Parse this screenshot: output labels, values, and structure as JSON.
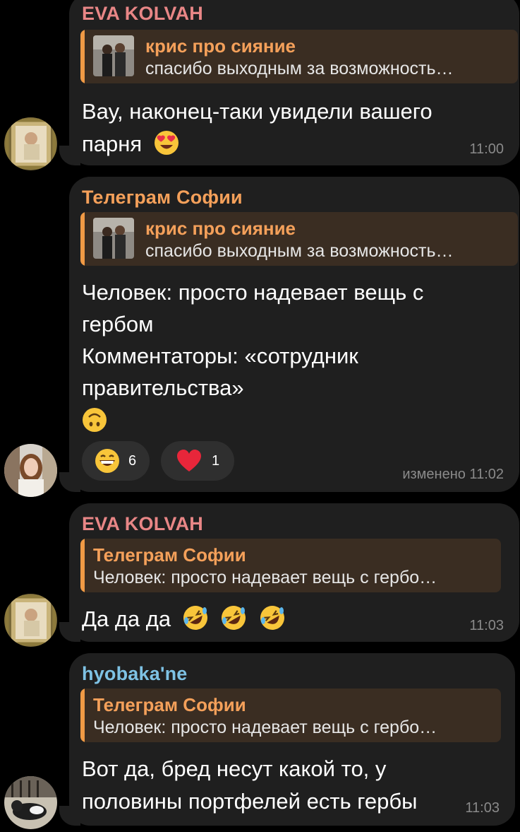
{
  "colors": {
    "eva": "#e88686",
    "sofia": "#f4a05a",
    "hyobaka": "#7ec2e4",
    "reply_orange": "#f09a45",
    "bubble": "#1f1f1f",
    "reply_bg": "#3a2d22",
    "time": "#8a8a8a"
  },
  "messages": [
    {
      "sender": "EVA KOLVAH",
      "reply_name": "крис про сияние",
      "reply_text": "спасибо выходным за возможность…",
      "lines": [
        "Вау, наконец-таки увидели вашего",
        "парня"
      ],
      "emoji": "heart-eyes",
      "time": "11:00"
    },
    {
      "sender": "Телеграм Софии",
      "reply_name": "крис про сияние",
      "reply_text": "спасибо выходным за возможность…",
      "lines": [
        "Человек: просто надевает вещь с",
        "гербом",
        "Комментаторы: «сотрудник",
        "правительства»"
      ],
      "emoji": "upside-down-face",
      "reactions": [
        {
          "emoji": "grinning-face",
          "count": "6"
        },
        {
          "emoji": "red-heart",
          "count": "1"
        }
      ],
      "time": "изменено 11:02"
    },
    {
      "sender": "EVA KOLVAH",
      "reply_name": "Телеграм Софии",
      "reply_text": "Человек: просто надевает вещь с гербо…",
      "lines": [
        "Да да да"
      ],
      "emoji": "rolling-on-floor-laughing",
      "time": "11:03"
    },
    {
      "sender": "hyobaka'ne",
      "reply_name": "Телеграм Софии",
      "reply_text": "Человек: просто надевает вещь с гербо…",
      "lines": [
        "Вот да, бред несут какой то, у",
        "половины портфелей есть гербы"
      ],
      "time": "11:03"
    }
  ]
}
